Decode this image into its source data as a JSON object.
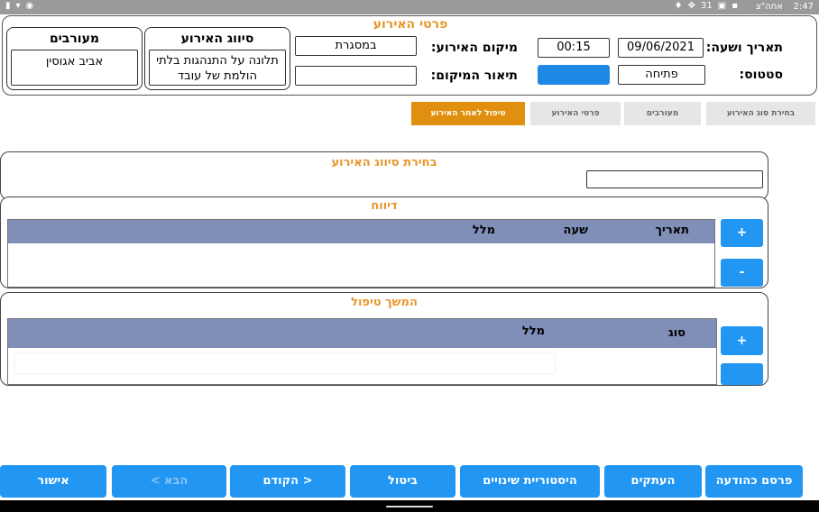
{
  "status_bar": {
    "time": "2:47",
    "carrier": "אחה\"צ",
    "right_icons": [
      "bell-icon",
      "network-icon",
      "calendar-icon",
      "image-icon",
      "photo-icon"
    ],
    "left_icons": [
      "battery-icon",
      "wifi-icon",
      "eye-icon"
    ],
    "calendar_day": "31"
  },
  "header": {
    "title": "פרטי האירוע",
    "date_time_label": "תאריך ושעה:",
    "date_value": "09/06/2021",
    "time_value": "00:15",
    "location_label": "מיקום האירוע:",
    "location_value": "במסגרת",
    "status_label": "סטטוס:",
    "status_value": "פתיחה",
    "status_button_label": "",
    "location_desc_label": "תיאור המיקום:",
    "location_desc_value": "",
    "classification": {
      "title": "סיווג האירוע",
      "value": "תלונה על התנהגות בלתי הולמת של עובד"
    },
    "involved": {
      "title": "מעורבים",
      "value": "אביב אגוסין"
    }
  },
  "tabs": [
    {
      "label": "בחירת סוג האירוע",
      "active": false
    },
    {
      "label": "מעורבים",
      "active": false
    },
    {
      "label": "פרטי האירוע",
      "active": false
    },
    {
      "label": "טיפול לאחר האירוע",
      "active": true
    }
  ],
  "classification_select": {
    "title": "בחירת סיווג האירוע",
    "value": ""
  },
  "report": {
    "title": "דיווח",
    "columns": [
      "תאריך",
      "שעה",
      "מלל"
    ],
    "add_label": "+",
    "remove_label": "-"
  },
  "followup": {
    "title": "המשך טיפול",
    "columns": [
      "סוג",
      "מלל"
    ],
    "add_label": "+",
    "remove_label": ""
  },
  "bottom_buttons": [
    {
      "label": "פרסם כהודעה",
      "enabled": true
    },
    {
      "label": "העתקים",
      "enabled": true
    },
    {
      "label": "היסטוריית שינויים",
      "enabled": true
    },
    {
      "label": "ביטול",
      "enabled": true
    },
    {
      "label": "< הקודם",
      "enabled": true
    },
    {
      "label": "הבא >",
      "enabled": false
    },
    {
      "label": "אישור",
      "enabled": true
    }
  ],
  "colors": {
    "accent_orange": "#e8962a",
    "tab_active": "#e0900e",
    "button_blue": "#2196f3",
    "grid_header": "#7f8fb8"
  }
}
